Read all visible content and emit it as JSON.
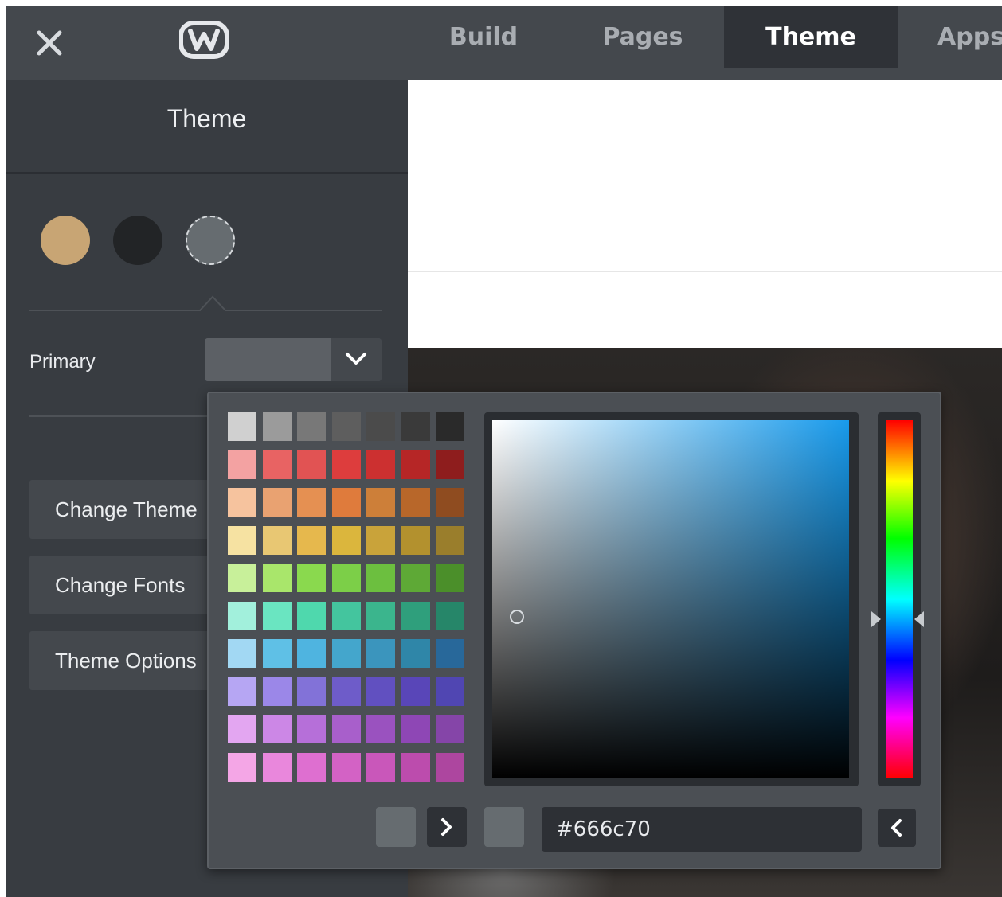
{
  "topbar": {
    "close_icon": "close-icon",
    "logo_icon": "weebly-logo-icon",
    "tabs": [
      {
        "label": "Build",
        "active": false
      },
      {
        "label": "Pages",
        "active": false
      },
      {
        "label": "Theme",
        "active": true
      },
      {
        "label": "Apps",
        "active": false
      }
    ]
  },
  "sidebar": {
    "title": "Theme",
    "swatches": [
      {
        "color": "#c8a574"
      },
      {
        "color": "#222426"
      },
      {
        "color": "#666c70",
        "selected": true
      }
    ],
    "primary": {
      "label": "Primary",
      "value": "#666c70",
      "caret_icon": "chevron-down-icon"
    },
    "buttons": [
      {
        "label": "Change Theme"
      },
      {
        "label": "Change Fonts"
      },
      {
        "label": "Theme Options"
      }
    ]
  },
  "color_picker": {
    "palette": [
      [
        "#d0d0d0",
        "#9b9b9b",
        "#787878",
        "#5e5e5e",
        "#4b4b4b",
        "#3a3a3a",
        "#2a2a2a"
      ],
      [
        "#f3a2a2",
        "#e86363",
        "#e15353",
        "#dd3d3d",
        "#cc3030",
        "#b62626",
        "#8e1d1d"
      ],
      [
        "#f6c39e",
        "#e9a271",
        "#e59052",
        "#df7b3c",
        "#cd7f39",
        "#b8672a",
        "#8f4c20"
      ],
      [
        "#f6e2a2",
        "#e8c773",
        "#e6b84d",
        "#dbb63d",
        "#c9a33a",
        "#b3912e",
        "#9a7e2c"
      ],
      [
        "#c8f09a",
        "#a9e66b",
        "#8ad94e",
        "#7ccf48",
        "#6cbf3f",
        "#5ea936",
        "#4b8f2a"
      ],
      [
        "#a2f0dc",
        "#6ae5c1",
        "#4fd8ad",
        "#44c59e",
        "#3bb58d",
        "#2f9f7c",
        "#268669"
      ],
      [
        "#a2d8f3",
        "#5fc0e6",
        "#4fb4e0",
        "#44a6cc",
        "#3b95bd",
        "#2f86a8",
        "#28689a"
      ],
      [
        "#b6a6f3",
        "#9b87e8",
        "#8272d8",
        "#6e5cc9",
        "#6150c0",
        "#5946b8",
        "#5046b2"
      ],
      [
        "#e3a6f1",
        "#cc87e6",
        "#b66fd9",
        "#a85fcb",
        "#9a52bf",
        "#8e47b5",
        "#8545a8"
      ],
      [
        "#f4a6e6",
        "#e987dc",
        "#de6fd0",
        "#d362c5",
        "#c957ba",
        "#bc4cad",
        "#ad469f"
      ]
    ],
    "sv_base_color": "#189aeb",
    "current_color": "#666c70",
    "hex_value": "#666c70",
    "next_icon": "chevron-right-icon",
    "prev_icon": "chevron-left-icon"
  }
}
